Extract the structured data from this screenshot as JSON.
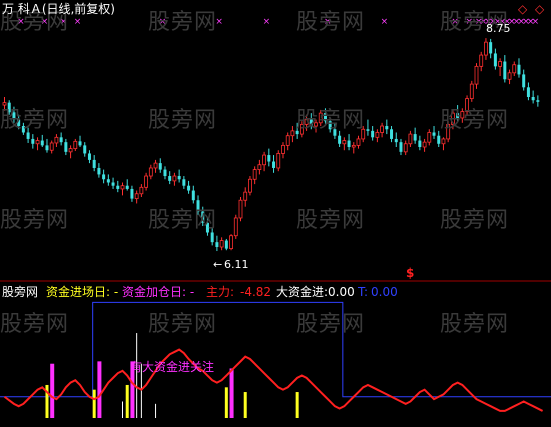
{
  "window": {
    "title": "万 科Ａ(日线,前复权)"
  },
  "colors": {
    "background": "#000000",
    "price_up": "#ff3030",
    "price_down": "#40e0e0",
    "marker": "#ff40ff",
    "divider": "#a00000",
    "main_line": "#ff2020",
    "fund_line": "#3040ff",
    "white": "#ffffff",
    "magenta": "#ff30ff",
    "yellow": "#ffff20"
  },
  "price_panel": {
    "high_label": "8.75",
    "low_label": "6.11",
    "signal_symbol": "$",
    "top_marker_symbol": "×"
  },
  "indicator_panel": {
    "source": "股旁网",
    "entry_label": "资金进场日: -",
    "add_label": "资金加仓日: -",
    "main_label": "主力:",
    "main_value": "-4.82",
    "big_label": "大资金进:",
    "big_value": "0.00",
    "t_label": "T:",
    "t_value": "0.00",
    "annotation": "有大资金进关注"
  },
  "watermark": {
    "text": "股旁网"
  },
  "controls": {
    "left_arrow": "◇",
    "right_arrow": "◇"
  },
  "chart_data": {
    "type": "candlestick",
    "ohlc": [
      [
        7.92,
        8.02,
        7.85,
        7.95
      ],
      [
        7.95,
        7.98,
        7.8,
        7.83
      ],
      [
        7.83,
        7.9,
        7.7,
        7.74
      ],
      [
        7.74,
        7.8,
        7.62,
        7.66
      ],
      [
        7.66,
        7.7,
        7.55,
        7.58
      ],
      [
        7.58,
        7.64,
        7.45,
        7.5
      ],
      [
        7.5,
        7.56,
        7.38,
        7.44
      ],
      [
        7.44,
        7.52,
        7.36,
        7.48
      ],
      [
        7.48,
        7.55,
        7.4,
        7.42
      ],
      [
        7.42,
        7.5,
        7.33,
        7.36
      ],
      [
        7.36,
        7.48,
        7.32,
        7.45
      ],
      [
        7.45,
        7.56,
        7.4,
        7.52
      ],
      [
        7.52,
        7.58,
        7.42,
        7.46
      ],
      [
        7.46,
        7.5,
        7.3,
        7.34
      ],
      [
        7.34,
        7.42,
        7.26,
        7.38
      ],
      [
        7.38,
        7.5,
        7.35,
        7.47
      ],
      [
        7.47,
        7.54,
        7.4,
        7.42
      ],
      [
        7.42,
        7.46,
        7.28,
        7.32
      ],
      [
        7.32,
        7.36,
        7.2,
        7.24
      ],
      [
        7.24,
        7.3,
        7.1,
        7.14
      ],
      [
        7.14,
        7.2,
        7.02,
        7.06
      ],
      [
        7.06,
        7.12,
        6.95,
        7.0
      ],
      [
        7.0,
        7.06,
        6.92,
        6.96
      ],
      [
        6.96,
        7.02,
        6.88,
        6.92
      ],
      [
        6.92,
        6.98,
        6.84,
        6.88
      ],
      [
        6.88,
        6.96,
        6.8,
        6.92
      ],
      [
        6.92,
        7.0,
        6.86,
        6.88
      ],
      [
        6.88,
        6.92,
        6.72,
        6.76
      ],
      [
        6.76,
        6.86,
        6.7,
        6.82
      ],
      [
        6.82,
        6.94,
        6.78,
        6.9
      ],
      [
        6.9,
        7.08,
        6.86,
        7.04
      ],
      [
        7.04,
        7.18,
        7.0,
        7.14
      ],
      [
        7.14,
        7.24,
        7.08,
        7.2
      ],
      [
        7.2,
        7.26,
        7.08,
        7.12
      ],
      [
        7.12,
        7.16,
        7.0,
        7.04
      ],
      [
        7.04,
        7.1,
        6.94,
        6.98
      ],
      [
        6.98,
        7.08,
        6.92,
        7.04
      ],
      [
        7.04,
        7.12,
        6.96,
        7.0
      ],
      [
        7.0,
        7.04,
        6.88,
        6.92
      ],
      [
        6.92,
        6.98,
        6.82,
        6.86
      ],
      [
        6.86,
        6.92,
        6.7,
        6.74
      ],
      [
        6.74,
        6.8,
        6.56,
        6.6
      ],
      [
        6.6,
        6.66,
        6.42,
        6.46
      ],
      [
        6.46,
        6.52,
        6.3,
        6.34
      ],
      [
        6.34,
        6.4,
        6.18,
        6.22
      ],
      [
        6.22,
        6.3,
        6.11,
        6.16
      ],
      [
        6.16,
        6.28,
        6.12,
        6.24
      ],
      [
        6.24,
        6.26,
        6.12,
        6.14
      ],
      [
        6.14,
        6.32,
        6.12,
        6.3
      ],
      [
        6.3,
        6.56,
        6.26,
        6.52
      ],
      [
        6.52,
        6.78,
        6.48,
        6.74
      ],
      [
        6.74,
        6.9,
        6.66,
        6.84
      ],
      [
        6.84,
        7.04,
        6.8,
        7.0
      ],
      [
        7.0,
        7.16,
        6.94,
        7.12
      ],
      [
        7.12,
        7.24,
        7.06,
        7.18
      ],
      [
        7.18,
        7.34,
        7.1,
        7.3
      ],
      [
        7.3,
        7.38,
        7.16,
        7.22
      ],
      [
        7.22,
        7.3,
        7.08,
        7.14
      ],
      [
        7.14,
        7.36,
        7.1,
        7.32
      ],
      [
        7.32,
        7.46,
        7.26,
        7.42
      ],
      [
        7.42,
        7.58,
        7.36,
        7.54
      ],
      [
        7.54,
        7.66,
        7.46,
        7.6
      ],
      [
        7.6,
        7.7,
        7.5,
        7.56
      ],
      [
        7.56,
        7.72,
        7.52,
        7.68
      ],
      [
        7.68,
        7.8,
        7.6,
        7.74
      ],
      [
        7.74,
        7.82,
        7.62,
        7.66
      ],
      [
        7.66,
        7.74,
        7.58,
        7.7
      ],
      [
        7.7,
        7.86,
        7.66,
        7.82
      ],
      [
        7.82,
        7.88,
        7.68,
        7.72
      ],
      [
        7.72,
        7.76,
        7.58,
        7.62
      ],
      [
        7.62,
        7.7,
        7.5,
        7.54
      ],
      [
        7.54,
        7.6,
        7.4,
        7.44
      ],
      [
        7.44,
        7.52,
        7.36,
        7.48
      ],
      [
        7.48,
        7.56,
        7.36,
        7.4
      ],
      [
        7.4,
        7.46,
        7.32,
        7.42
      ],
      [
        7.42,
        7.54,
        7.38,
        7.5
      ],
      [
        7.5,
        7.66,
        7.46,
        7.62
      ],
      [
        7.62,
        7.74,
        7.54,
        7.6
      ],
      [
        7.6,
        7.66,
        7.48,
        7.52
      ],
      [
        7.52,
        7.62,
        7.46,
        7.58
      ],
      [
        7.58,
        7.7,
        7.52,
        7.66
      ],
      [
        7.66,
        7.74,
        7.56,
        7.62
      ],
      [
        7.62,
        7.66,
        7.46,
        7.5
      ],
      [
        7.5,
        7.58,
        7.4,
        7.46
      ],
      [
        7.46,
        7.5,
        7.3,
        7.34
      ],
      [
        7.34,
        7.48,
        7.3,
        7.44
      ],
      [
        7.44,
        7.6,
        7.4,
        7.56
      ],
      [
        7.56,
        7.64,
        7.44,
        7.48
      ],
      [
        7.48,
        7.54,
        7.36,
        7.4
      ],
      [
        7.4,
        7.5,
        7.34,
        7.46
      ],
      [
        7.46,
        7.62,
        7.42,
        7.58
      ],
      [
        7.58,
        7.66,
        7.5,
        7.54
      ],
      [
        7.54,
        7.6,
        7.4,
        7.44
      ],
      [
        7.44,
        7.52,
        7.36,
        7.5
      ],
      [
        7.5,
        7.72,
        7.46,
        7.68
      ],
      [
        7.68,
        7.86,
        7.62,
        7.82
      ],
      [
        7.82,
        7.92,
        7.72,
        7.76
      ],
      [
        7.76,
        7.88,
        7.7,
        7.84
      ],
      [
        7.84,
        8.04,
        7.8,
        8.0
      ],
      [
        8.0,
        8.22,
        7.96,
        8.18
      ],
      [
        8.18,
        8.44,
        8.12,
        8.4
      ],
      [
        8.4,
        8.58,
        8.34,
        8.54
      ],
      [
        8.54,
        8.75,
        8.48,
        8.7
      ],
      [
        8.7,
        8.74,
        8.5,
        8.56
      ],
      [
        8.56,
        8.62,
        8.36,
        8.4
      ],
      [
        8.4,
        8.5,
        8.28,
        8.46
      ],
      [
        8.46,
        8.54,
        8.2,
        8.24
      ],
      [
        8.24,
        8.36,
        8.18,
        8.32
      ],
      [
        8.32,
        8.46,
        8.28,
        8.42
      ],
      [
        8.42,
        8.5,
        8.26,
        8.3
      ],
      [
        8.3,
        8.36,
        8.1,
        8.14
      ],
      [
        8.14,
        8.2,
        7.98,
        8.02
      ],
      [
        8.02,
        8.1,
        7.94,
        7.98
      ],
      [
        7.98,
        8.04,
        7.9,
        7.96
      ]
    ],
    "price_range": [
      5.85,
      8.95
    ],
    "signal_bar_index": 95,
    "top_markers": [
      3,
      8,
      12,
      15,
      33,
      45,
      55,
      68,
      80,
      95,
      98,
      100,
      101,
      102,
      103,
      104,
      105,
      106,
      107,
      108,
      109,
      110,
      111,
      112
    ],
    "annotations": [
      {
        "label": "8.75",
        "bar": 103,
        "value": 8.75
      },
      {
        "label": "6.11",
        "bar": 45,
        "value": 6.11
      }
    ],
    "indicator": {
      "main_force_line": [
        0.18,
        0.15,
        0.12,
        0.1,
        0.12,
        0.16,
        0.2,
        0.24,
        0.26,
        0.22,
        0.18,
        0.16,
        0.2,
        0.26,
        0.3,
        0.32,
        0.28,
        0.22,
        0.18,
        0.16,
        0.18,
        0.24,
        0.3,
        0.34,
        0.38,
        0.4,
        0.36,
        0.3,
        0.26,
        0.24,
        0.28,
        0.34,
        0.4,
        0.46,
        0.5,
        0.54,
        0.56,
        0.58,
        0.55,
        0.5,
        0.46,
        0.42,
        0.4,
        0.36,
        0.32,
        0.3,
        0.32,
        0.36,
        0.4,
        0.44,
        0.48,
        0.52,
        0.5,
        0.46,
        0.42,
        0.38,
        0.34,
        0.3,
        0.26,
        0.24,
        0.26,
        0.3,
        0.34,
        0.36,
        0.34,
        0.3,
        0.26,
        0.22,
        0.18,
        0.14,
        0.1,
        0.08,
        0.1,
        0.14,
        0.18,
        0.22,
        0.26,
        0.28,
        0.26,
        0.24,
        0.22,
        0.2,
        0.18,
        0.16,
        0.14,
        0.12,
        0.14,
        0.18,
        0.22,
        0.24,
        0.2,
        0.16,
        0.18,
        0.2,
        0.24,
        0.28,
        0.3,
        0.28,
        0.24,
        0.2,
        0.16,
        0.14,
        0.12,
        0.1,
        0.08,
        0.06,
        0.06,
        0.08,
        0.1,
        0.12,
        0.14,
        0.12,
        0.1,
        0.08,
        0.06
      ],
      "fund_band": {
        "start": 19,
        "end": 72,
        "high": 0.98,
        "low": 0.18
      },
      "magenta_bars": [
        {
          "bar": 10,
          "value": 0.46
        },
        {
          "bar": 20,
          "value": 0.48
        },
        {
          "bar": 27,
          "value": 0.48
        },
        {
          "bar": 48,
          "value": 0.42
        }
      ],
      "yellow_bars": [
        {
          "bar": 9,
          "value": 0.28
        },
        {
          "bar": 19,
          "value": 0.24
        },
        {
          "bar": 26,
          "value": 0.28
        },
        {
          "bar": 47,
          "value": 0.26
        },
        {
          "bar": 51,
          "value": 0.22
        },
        {
          "bar": 62,
          "value": 0.22
        }
      ],
      "white_bars": [
        {
          "bar": 28,
          "value": 0.72
        },
        {
          "bar": 29,
          "value": 0.46
        },
        {
          "bar": 25,
          "value": 0.14
        },
        {
          "bar": 32,
          "value": 0.12
        }
      ],
      "range": [
        0,
        1
      ]
    }
  }
}
